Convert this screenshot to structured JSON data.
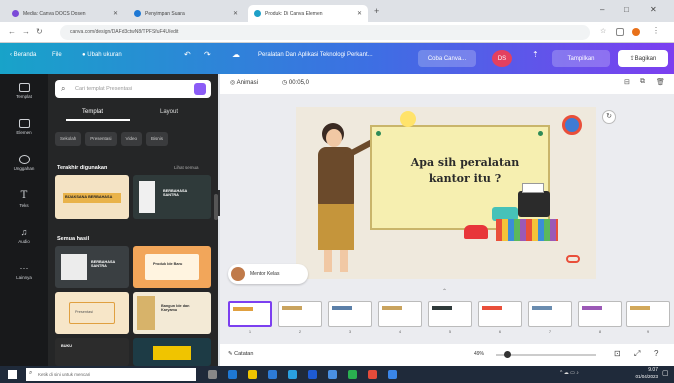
{
  "browser": {
    "tabs": [
      {
        "label": "Media: Canva DOCS Dosen"
      },
      {
        "label": "Penyimpan Suara"
      },
      {
        "label": "Produk: Di Canva Elemen"
      }
    ],
    "url": "canva.com/design/DAFd3ctwN8/TPFSfuF4U/edit"
  },
  "canva_header": {
    "home": "Beranda",
    "file": "File",
    "resize": "Ubah ukuran",
    "doc_title": "Peralatan Dan Aplikasi Teknologi Perkant...",
    "share_edit": "Coba Canva...",
    "avatar": "DS",
    "present": "Tampilkan",
    "share": "Bagikan"
  },
  "rail": [
    {
      "label": "Templat"
    },
    {
      "label": "Elemen"
    },
    {
      "label": "Unggahan"
    },
    {
      "label": "Teks"
    },
    {
      "label": "Audio"
    },
    {
      "label": "Lainnya"
    }
  ],
  "panel": {
    "search_placeholder": "Cari templat Presentasi",
    "tabs": [
      "Templat",
      "Layout"
    ],
    "chips": [
      "Sekolah",
      "Presentasi",
      "Video",
      "Bisnis"
    ],
    "recent_title": "Terakhir digunakan",
    "recent_link": "Lihat semua",
    "all_title": "Semua hasil",
    "thumbs": [
      {
        "caption": "BIJAKSANA BERBAHASA"
      },
      {
        "caption": "BERBAHASA SANTRA"
      },
      {
        "caption": "BERBAHASA SANTRA"
      },
      {
        "caption": "Produk Ide Baru"
      },
      {
        "caption": "Presentasi"
      },
      {
        "caption": "Bangun Ide dan Karyamu"
      },
      {
        "caption": "BUKU"
      },
      {
        "caption": ""
      }
    ]
  },
  "toolbar": {
    "animate": "Animasi",
    "duration": "00:05,0"
  },
  "slide": {
    "title": "Apa sih peralatan kantor itu ?"
  },
  "presenter": {
    "name": "Mentor Kelas"
  },
  "pages": [
    "1",
    "2",
    "3",
    "4",
    "5",
    "6",
    "7",
    "8",
    "9"
  ],
  "footer": {
    "notes": "Catatan",
    "zoom": "49%"
  },
  "taskbar": {
    "search": "Ketik di sini untuk mencari",
    "time": "9.07",
    "date": "01/04/2023"
  },
  "colors": {
    "accent": "#7c3ff0",
    "cyan": "#18a3c9",
    "rail": "#18191b",
    "panel": "#252627",
    "board": "#f6efb0"
  }
}
